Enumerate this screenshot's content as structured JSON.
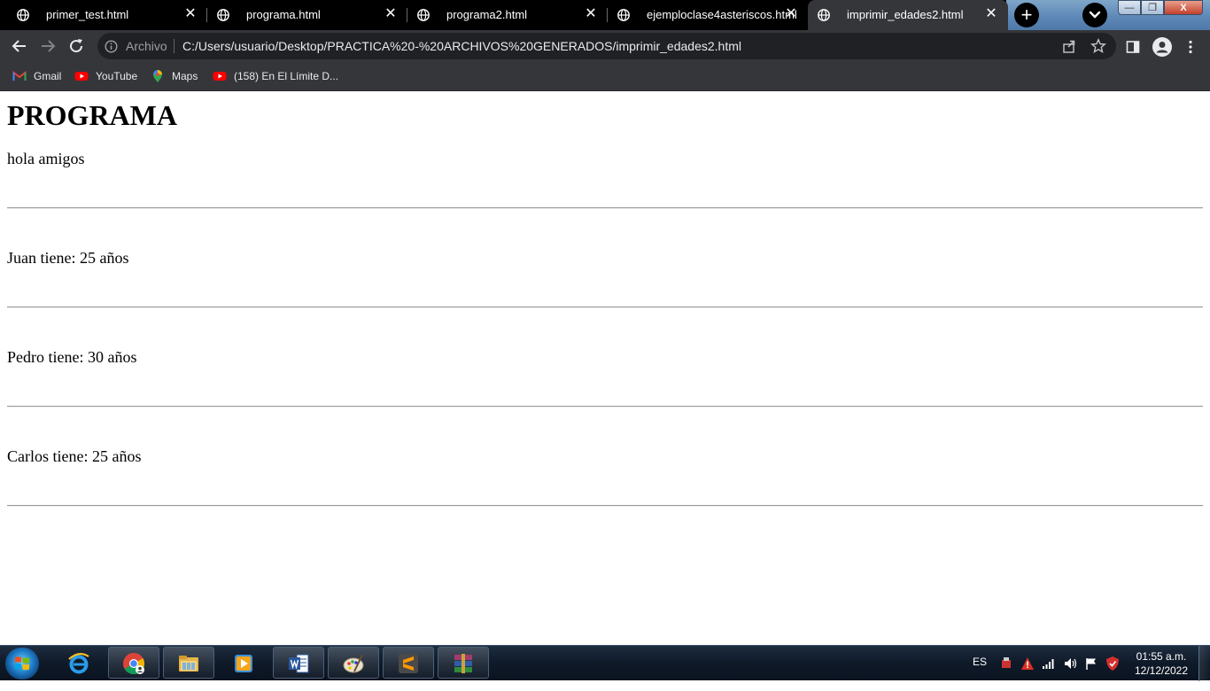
{
  "browser": {
    "tabs": [
      {
        "title": "primer_test.html",
        "active": false
      },
      {
        "title": "programa.html",
        "active": false
      },
      {
        "title": "programa2.html",
        "active": false
      },
      {
        "title": "ejemploclase4asteriscos.html",
        "active": false
      },
      {
        "title": "imprimir_edades2.html",
        "active": true
      }
    ],
    "new_tab_label": "+",
    "window": {
      "minimize": "—",
      "maximize": "❐",
      "close": "X"
    },
    "omnibox": {
      "security_label": "Archivo",
      "url": "C:/Users/usuario/Desktop/PRACTICA%20-%20ARCHIVOS%20GENERADOS/imprimir_edades2.html"
    },
    "bookmarks": [
      {
        "label": "Gmail",
        "icon": "gmail-icon"
      },
      {
        "label": "YouTube",
        "icon": "youtube-icon"
      },
      {
        "label": "Maps",
        "icon": "maps-icon"
      },
      {
        "label": "(158) En El Límite D...",
        "icon": "youtube-icon"
      }
    ]
  },
  "page": {
    "heading": "PROGRAMA",
    "intro": "hola amigos",
    "lines": [
      "Juan tiene: 25 años",
      "Pedro tiene: 30 años",
      "Carlos tiene: 25 años"
    ]
  },
  "taskbar": {
    "apps": [
      "internet-explorer-icon",
      "chrome-icon",
      "file-explorer-icon",
      "media-player-icon",
      "word-icon",
      "paint-icon",
      "sublime-text-icon",
      "winrar-icon"
    ],
    "language": "ES",
    "time": "01:55 a.m.",
    "date": "12/12/2022"
  }
}
